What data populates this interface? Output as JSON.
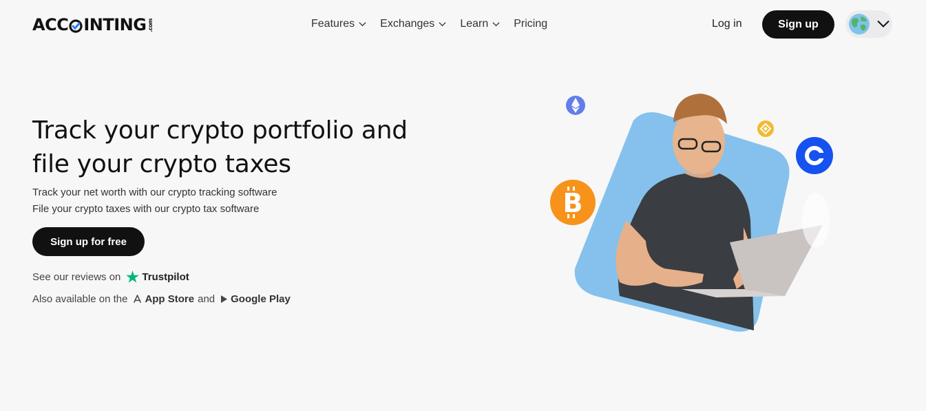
{
  "brand": {
    "logo_text_a": "ACC",
    "logo_text_b": "INTING",
    "logo_suffix": ".com"
  },
  "nav": {
    "items": [
      {
        "label": "Features",
        "has_dropdown": true
      },
      {
        "label": "Exchanges",
        "has_dropdown": true
      },
      {
        "label": "Learn",
        "has_dropdown": true
      },
      {
        "label": "Pricing",
        "has_dropdown": false
      }
    ]
  },
  "header": {
    "login_label": "Log in",
    "signup_label": "Sign up",
    "language_icon": "globe-icon"
  },
  "hero": {
    "title_line1": "Track your crypto portfolio and",
    "title_line2": "file your crypto taxes",
    "subtitle_line1": "Track your net worth with our crypto tracking software",
    "subtitle_line2": "File your crypto taxes with our crypto tax software",
    "cta_label": "Sign up for free",
    "reviews_prefix": "See our reviews on",
    "reviews_brand": "Trustpilot",
    "available_prefix": "Also available on the",
    "app_store": "App Store",
    "and_word": "and",
    "google_play": "Google Play"
  },
  "colors": {
    "accent_dark": "#111111",
    "background": "#f7f7f8",
    "trustpilot_green": "#00b67a",
    "bitcoin_orange": "#f7931a",
    "coinbase_blue": "#1652f0",
    "ethereum_purple": "#627eea",
    "binance_yellow": "#f3ba2f",
    "illustration_blue": "#85c1ec"
  }
}
